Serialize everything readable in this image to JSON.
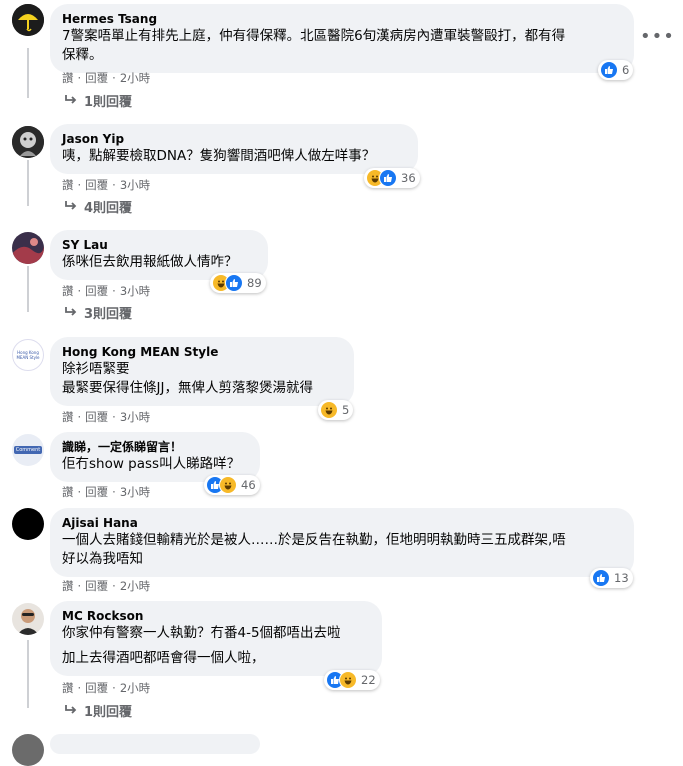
{
  "colors": {
    "like": "#1877f2",
    "haha": "#f7b928",
    "bubble": "#f0f2f5",
    "meta": "#65676b"
  },
  "action_labels": {
    "like": "讚",
    "reply": "回覆",
    "sep": "·"
  },
  "comments": [
    {
      "author": "Hermes Tsang",
      "lines": [
        "7警案唔單止有排先上庭，仲有得保釋。北區醫院6旬漢病房內遭軍裝警毆打，都有得",
        "保釋。"
      ],
      "time": "2小時",
      "reactions": [
        "like"
      ],
      "count": "6",
      "replies": "1則回覆"
    },
    {
      "author": "Jason Yip",
      "lines": [
        "咦，點解要檢取DNA？隻狗響間酒吧俾人做左咩事？"
      ],
      "time": "3小時",
      "reactions": [
        "haha",
        "like"
      ],
      "count": "36",
      "replies": "4則回覆"
    },
    {
      "author": "SY Lau",
      "lines": [
        "係咪佢去飲用報紙做人情咋？"
      ],
      "time": "3小時",
      "reactions": [
        "haha",
        "like"
      ],
      "count": "89",
      "replies": "3則回覆"
    },
    {
      "author": "Hong Kong MEAN Style",
      "lines": [
        "除衫唔緊要",
        "最緊要保得住條JJ，無俾人剪落黎煲湯就得"
      ],
      "time": "3小時",
      "reactions": [
        "haha"
      ],
      "count": "5",
      "avatar_text": "Hong Kong MEAN Style"
    },
    {
      "author": "識睇，一定係睇留言！",
      "lines": [
        "佢冇show pass叫人睇路咩？"
      ],
      "time": "3小時",
      "reactions": [
        "like",
        "haha"
      ],
      "count": "46",
      "avatar_text": "Comment"
    },
    {
      "author": "Ajisai Hana",
      "lines": [
        "一個人去賭錢但輸精光於是被人……於是反告在執勤，佢地明明執勤時三五成群架,唔",
        "好以為我唔知"
      ],
      "time": "2小時",
      "reactions": [
        "like"
      ],
      "count": "13"
    },
    {
      "author": "MC Rockson",
      "lines": [
        "你家仲有警察一人執勤？冇番4-5個都唔出去啦",
        "加上去得酒吧都唔會得一個人啦，"
      ],
      "time": "2小時",
      "reactions": [
        "like",
        "haha"
      ],
      "count": "22",
      "replies": "1則回覆"
    }
  ]
}
